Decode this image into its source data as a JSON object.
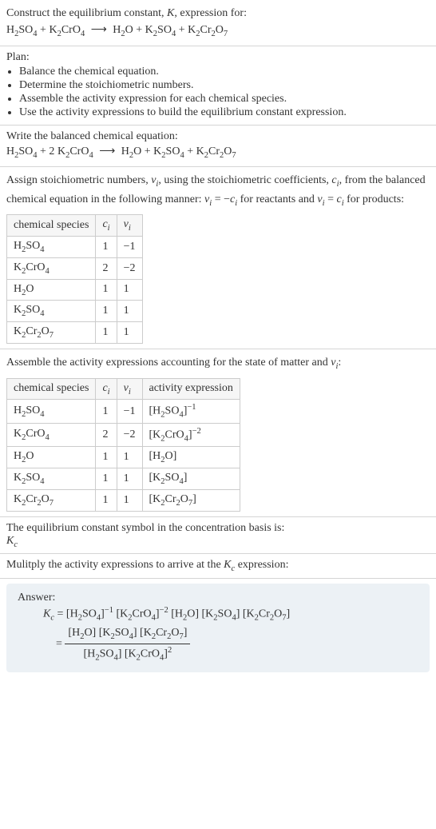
{
  "header": {
    "line1_prefix": "Construct the equilibrium constant, ",
    "line1_K": "K",
    "line1_suffix": ", expression for:",
    "eq": {
      "r1": "H",
      "r1s": "2",
      "r1b": "SO",
      "r1bs": "4",
      "plus1": " + ",
      "r2": "K",
      "r2s": "2",
      "r2b": "CrO",
      "r2bs": "4",
      "arrow": "⟶",
      "p1": "H",
      "p1s": "2",
      "p1b": "O",
      "plus2": " + ",
      "p2": "K",
      "p2s": "2",
      "p2b": "SO",
      "p2bs": "4",
      "plus3": " + ",
      "p3": "K",
      "p3s": "2",
      "p3b": "Cr",
      "p3bs": "2",
      "p3c": "O",
      "p3cs": "7"
    }
  },
  "plan": {
    "label": "Plan:",
    "items": [
      "Balance the chemical equation.",
      "Determine the stoichiometric numbers.",
      "Assemble the activity expression for each chemical species.",
      "Use the activity expressions to build the equilibrium constant expression."
    ]
  },
  "balanced": {
    "label": "Write the balanced chemical equation:",
    "eq": {
      "r1": "H",
      "r1s": "2",
      "r1b": "SO",
      "r1bs": "4",
      "plus1": " + 2 ",
      "r2": "K",
      "r2s": "2",
      "r2b": "CrO",
      "r2bs": "4",
      "arrow": "⟶",
      "p1": "H",
      "p1s": "2",
      "p1b": "O",
      "plus2": " + ",
      "p2": "K",
      "p2s": "2",
      "p2b": "SO",
      "p2bs": "4",
      "plus3": " + ",
      "p3": "K",
      "p3s": "2",
      "p3b": "Cr",
      "p3bs": "2",
      "p3c": "O",
      "p3cs": "7"
    }
  },
  "stoich": {
    "text1": "Assign stoichiometric numbers, ",
    "nu": "ν",
    "nu_i": "i",
    "text2": ", using the stoichiometric coefficients, ",
    "c": "c",
    "c_i": "i",
    "text3": ", from the balanced chemical equation in the following manner: ",
    "eq1a": "ν",
    "eq1ai": "i",
    "eq1m": " = −",
    "eq1b": "c",
    "eq1bi": "i",
    "text4": " for reactants and ",
    "eq2a": "ν",
    "eq2ai": "i",
    "eq2m": " = ",
    "eq2b": "c",
    "eq2bi": "i",
    "text5": " for products:",
    "headers": {
      "h1": "chemical species",
      "h2": "c",
      "h2i": "i",
      "h3": "ν",
      "h3i": "i"
    },
    "rows": [
      {
        "s": {
          "a": "H",
          "as": "2",
          "b": "SO",
          "bs": "4"
        },
        "c": "1",
        "v": "−1"
      },
      {
        "s": {
          "a": "K",
          "as": "2",
          "b": "CrO",
          "bs": "4"
        },
        "c": "2",
        "v": "−2"
      },
      {
        "s": {
          "a": "H",
          "as": "2",
          "b": "O"
        },
        "c": "1",
        "v": "1"
      },
      {
        "s": {
          "a": "K",
          "as": "2",
          "b": "SO",
          "bs": "4"
        },
        "c": "1",
        "v": "1"
      },
      {
        "s": {
          "a": "K",
          "as": "2",
          "b": "Cr",
          "bs": "2",
          "c": "O",
          "cs": "7"
        },
        "c": "1",
        "v": "1"
      }
    ]
  },
  "activity": {
    "label1": "Assemble the activity expressions accounting for the state of matter and ",
    "nu": "ν",
    "nu_i": "i",
    "label2": ":",
    "headers": {
      "h1": "chemical species",
      "h2": "c",
      "h2i": "i",
      "h3": "ν",
      "h3i": "i",
      "h4": "activity expression"
    },
    "rows": [
      {
        "s": {
          "a": "H",
          "as": "2",
          "b": "SO",
          "bs": "4"
        },
        "c": "1",
        "v": "−1",
        "ae": {
          "a": "[H",
          "as": "2",
          "b": "SO",
          "bs": "4",
          "br": "]",
          "exp": "−1"
        }
      },
      {
        "s": {
          "a": "K",
          "as": "2",
          "b": "CrO",
          "bs": "4"
        },
        "c": "2",
        "v": "−2",
        "ae": {
          "a": "[K",
          "as": "2",
          "b": "CrO",
          "bs": "4",
          "br": "]",
          "exp": "−2"
        }
      },
      {
        "s": {
          "a": "H",
          "as": "2",
          "b": "O"
        },
        "c": "1",
        "v": "1",
        "ae": {
          "a": "[H",
          "as": "2",
          "b": "O]",
          "bs": ""
        }
      },
      {
        "s": {
          "a": "K",
          "as": "2",
          "b": "SO",
          "bs": "4"
        },
        "c": "1",
        "v": "1",
        "ae": {
          "a": "[K",
          "as": "2",
          "b": "SO",
          "bs": "4",
          "br": "]"
        }
      },
      {
        "s": {
          "a": "K",
          "as": "2",
          "b": "Cr",
          "bs": "2",
          "c": "O",
          "cs": "7"
        },
        "c": "1",
        "v": "1",
        "ae": {
          "a": "[K",
          "as": "2",
          "b": "Cr",
          "bs": "2",
          "c": "O",
          "cs": "7",
          "br": "]"
        }
      }
    ]
  },
  "basis": {
    "line1": "The equilibrium constant symbol in the concentration basis is:",
    "K": "K",
    "Kc": "c"
  },
  "mult": {
    "line1a": "Mulitply the activity expressions to arrive at the ",
    "K": "K",
    "Kc": "c",
    "line1b": " expression:"
  },
  "answer": {
    "label": "Answer:",
    "lhs_K": "K",
    "lhs_c": "c",
    "eq": " = ",
    "line1": {
      "t1": "[H",
      "t1s": "2",
      "t2": "SO",
      "t2s": "4",
      "t3": "]",
      "t3e": "−1",
      "sp1": " ",
      "t4": "[K",
      "t4s": "2",
      "t5": "CrO",
      "t5s": "4",
      "t6": "]",
      "t6e": "−2",
      "sp2": " ",
      "t7": "[H",
      "t7s": "2",
      "t8": "O] ",
      "t9": "[K",
      "t9s": "2",
      "t10": "SO",
      "t10s": "4",
      "t11": "] ",
      "t12": "[K",
      "t12s": "2",
      "t13": "Cr",
      "t13s": "2",
      "t14": "O",
      "t14s": "7",
      "t15": "]"
    },
    "eq2": " = ",
    "num": {
      "t1": "[H",
      "t1s": "2",
      "t2": "O] [K",
      "t2s": "2",
      "t3": "SO",
      "t3s": "4",
      "t4": "] [K",
      "t4s": "2",
      "t5": "Cr",
      "t5s": "2",
      "t6": "O",
      "t6s": "7",
      "t7": "]"
    },
    "den": {
      "t1": "[H",
      "t1s": "2",
      "t2": "SO",
      "t2s": "4",
      "t3": "] [K",
      "t3s": "2",
      "t4": "CrO",
      "t4s": "4",
      "t5": "]",
      "t5e": "2"
    }
  }
}
